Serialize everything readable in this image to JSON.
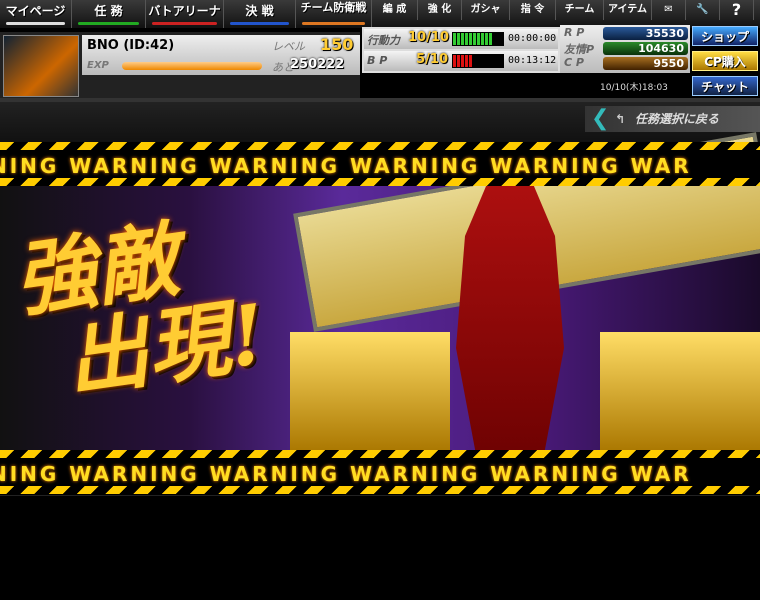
{
  "nav": {
    "main": [
      {
        "label": "マイページ",
        "color": "#dddddd"
      },
      {
        "label": "任 務",
        "color": "#22aa22"
      },
      {
        "label": "バトアリーナ",
        "color": "#cc2222"
      },
      {
        "label": "決 戦",
        "color": "#2255cc"
      },
      {
        "label": "チーム防衛戦",
        "color": "#dd7722"
      }
    ],
    "sub": [
      "編 成",
      "強 化",
      "ガシャ",
      "指 令",
      "チーム",
      "アイテム"
    ],
    "icons": [
      "mail-icon",
      "wrench-icon",
      "help-icon"
    ],
    "help": "?"
  },
  "profile": {
    "name": "BNO (ID:42)",
    "level_label": "レベル",
    "level": "150",
    "exp_label": "EXP",
    "exp_fraction": 0.95,
    "remaining_label": "あと",
    "remaining": "250222"
  },
  "stamina": {
    "action_label": "行動力",
    "action": "10/10",
    "action_fill": 1.0,
    "action_time": "00:00:00",
    "bp_label": "B P",
    "bp": "5/10",
    "bp_fill": 0.5,
    "bp_time": "00:13:12"
  },
  "currency": [
    {
      "label": "R P",
      "value": "35530",
      "color": "#1a4a8a"
    },
    {
      "label": "友情P",
      "value": "104630",
      "color": "#1a6a1a"
    },
    {
      "label": "C P",
      "value": "9550",
      "color": "#8a5a10"
    }
  ],
  "buttons": {
    "shop": "ショップ",
    "cp": "CP購入",
    "chat": "チャット"
  },
  "datetime": "10/10(木)18:03",
  "back": "任務選択に戻る",
  "banner": {
    "title1": "強敵",
    "title2": "出現!",
    "warning": "NING WARNING WARNING WARNING WARNING WAR"
  }
}
